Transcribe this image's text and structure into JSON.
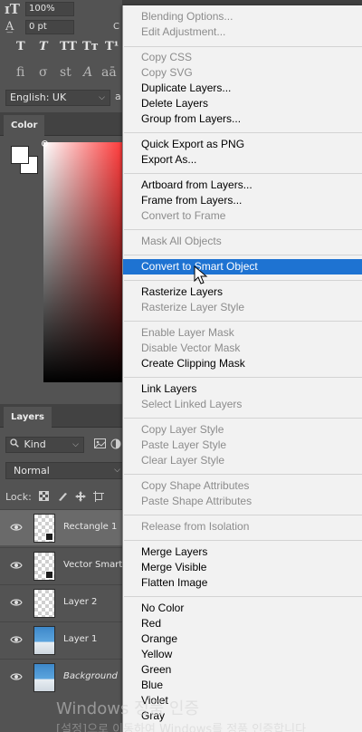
{
  "character_panel": {
    "font_size_value": "100%",
    "tracking_value": "0 pt",
    "style_buttons": [
      "T",
      "T",
      "TT",
      "Tт",
      "T¹"
    ],
    "opentype_buttons": [
      "fi",
      "σ",
      "st",
      "A",
      "aā"
    ],
    "language": "English: UK"
  },
  "color_panel": {
    "tab_label": "Color",
    "foreground": "#ffffff",
    "background": "#ffffff"
  },
  "layers_panel": {
    "tab_label": "Layers",
    "filter_kind": "Kind",
    "blend_mode": "Normal",
    "lock_label": "Lock:",
    "layers": [
      {
        "name": "Rectangle 1",
        "selected": true,
        "thumb": "transparent",
        "badge": true,
        "italic": false
      },
      {
        "name": "Vector Smart O",
        "selected": false,
        "thumb": "transparent",
        "badge": true,
        "italic": false
      },
      {
        "name": "Layer 2",
        "selected": false,
        "thumb": "transparent",
        "badge": false,
        "italic": false
      },
      {
        "name": "Layer 1",
        "selected": false,
        "thumb": "photo",
        "badge": false,
        "italic": false
      },
      {
        "name": "Background",
        "selected": false,
        "thumb": "photo",
        "badge": false,
        "italic": true
      }
    ]
  },
  "context_menu": {
    "groups": [
      [
        {
          "label": "Blending Options...",
          "enabled": false
        },
        {
          "label": "Edit Adjustment...",
          "enabled": false
        }
      ],
      [
        {
          "label": "Copy CSS",
          "enabled": false
        },
        {
          "label": "Copy SVG",
          "enabled": false
        },
        {
          "label": "Duplicate Layers...",
          "enabled": true
        },
        {
          "label": "Delete Layers",
          "enabled": true
        },
        {
          "label": "Group from Layers...",
          "enabled": true
        }
      ],
      [
        {
          "label": "Quick Export as PNG",
          "enabled": true
        },
        {
          "label": "Export As...",
          "enabled": true
        }
      ],
      [
        {
          "label": "Artboard from Layers...",
          "enabled": true
        },
        {
          "label": "Frame from Layers...",
          "enabled": true
        },
        {
          "label": "Convert to Frame",
          "enabled": false
        }
      ],
      [
        {
          "label": "Mask All Objects",
          "enabled": false
        }
      ],
      [
        {
          "label": "Convert to Smart Object",
          "enabled": true,
          "highlighted": true
        }
      ],
      [
        {
          "label": "Rasterize Layers",
          "enabled": true
        },
        {
          "label": "Rasterize Layer Style",
          "enabled": false
        }
      ],
      [
        {
          "label": "Enable Layer Mask",
          "enabled": false
        },
        {
          "label": "Disable Vector Mask",
          "enabled": false
        },
        {
          "label": "Create Clipping Mask",
          "enabled": true
        }
      ],
      [
        {
          "label": "Link Layers",
          "enabled": true
        },
        {
          "label": "Select Linked Layers",
          "enabled": false
        }
      ],
      [
        {
          "label": "Copy Layer Style",
          "enabled": false
        },
        {
          "label": "Paste Layer Style",
          "enabled": false
        },
        {
          "label": "Clear Layer Style",
          "enabled": false
        }
      ],
      [
        {
          "label": "Copy Shape Attributes",
          "enabled": false
        },
        {
          "label": "Paste Shape Attributes",
          "enabled": false
        }
      ],
      [
        {
          "label": "Release from Isolation",
          "enabled": false
        }
      ],
      [
        {
          "label": "Merge Layers",
          "enabled": true
        },
        {
          "label": "Merge Visible",
          "enabled": true
        },
        {
          "label": "Flatten Image",
          "enabled": true
        }
      ],
      [
        {
          "label": "No Color",
          "enabled": true
        },
        {
          "label": "Red",
          "enabled": true
        },
        {
          "label": "Orange",
          "enabled": true
        },
        {
          "label": "Yellow",
          "enabled": true
        },
        {
          "label": "Green",
          "enabled": true
        },
        {
          "label": "Blue",
          "enabled": true
        },
        {
          "label": "Violet",
          "enabled": true
        },
        {
          "label": "Gray",
          "enabled": true
        }
      ]
    ]
  },
  "watermark": {
    "line1": "Windows 정품 인증",
    "line2": "[설정]으로 이동하여 Windows를 정품 인증합니다"
  },
  "colors": {
    "menu_highlight": "#1e73d2",
    "menu_bg": "#f2f2f2",
    "panel_bg": "#535353"
  }
}
